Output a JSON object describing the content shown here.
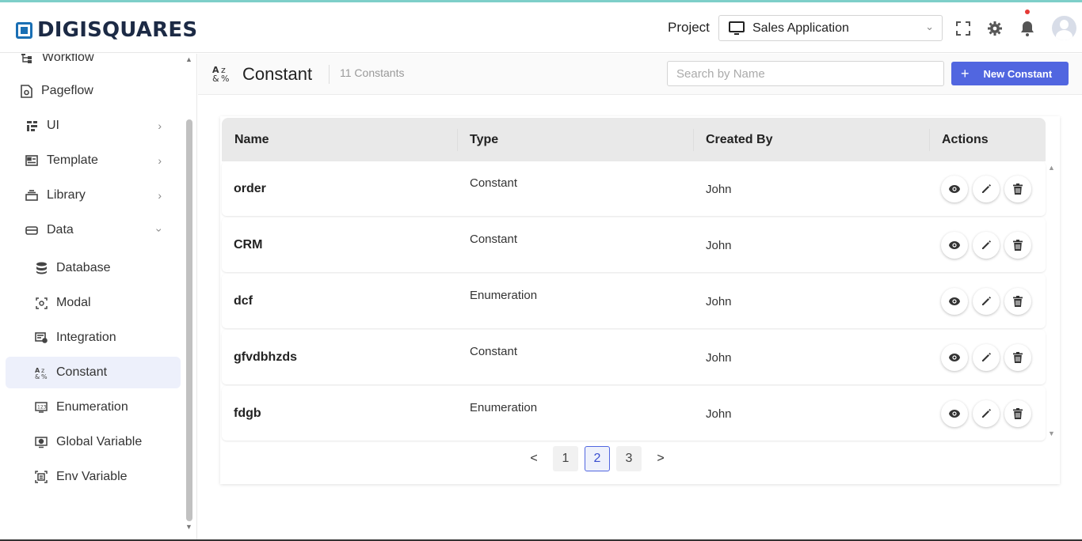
{
  "brand": {
    "name": "DIGISQUARES"
  },
  "header": {
    "project_label": "Project",
    "project_selected": "Sales Application",
    "icons": [
      "fullscreen-icon",
      "gear-icon",
      "bell-icon",
      "avatar"
    ]
  },
  "sidebar": {
    "items": [
      {
        "label": "Workflow",
        "icon": "workflow-icon",
        "has_arrow": false
      },
      {
        "label": "Pageflow",
        "icon": "pageflow-icon",
        "has_arrow": false
      },
      {
        "label": "UI",
        "icon": "ui-icon",
        "has_arrow": true
      },
      {
        "label": "Template",
        "icon": "template-icon",
        "has_arrow": true
      },
      {
        "label": "Library",
        "icon": "library-icon",
        "has_arrow": true
      },
      {
        "label": "Data",
        "icon": "data-icon",
        "has_arrow": true,
        "expanded": true
      },
      {
        "label": "Database",
        "icon": "database-icon"
      },
      {
        "label": "Modal",
        "icon": "modal-icon"
      },
      {
        "label": "Integration",
        "icon": "integration-icon"
      },
      {
        "label": "Constant",
        "icon": "constant-icon",
        "active": true
      },
      {
        "label": "Enumeration",
        "icon": "enumeration-icon"
      },
      {
        "label": "Global Variable",
        "icon": "global-variable-icon"
      },
      {
        "label": "Env Variable",
        "icon": "env-variable-icon"
      }
    ]
  },
  "toolbar": {
    "title": "Constant",
    "count": "11 Constants",
    "search_placeholder": "Search by Name",
    "new_button": "New Constant",
    "plus": "+"
  },
  "table": {
    "columns": [
      "Name",
      "Type",
      "Created By",
      "Actions"
    ],
    "rows": [
      {
        "name": "order",
        "type": "Constant",
        "created_by": "John"
      },
      {
        "name": "CRM",
        "type": "Constant",
        "created_by": "John"
      },
      {
        "name": "dcf",
        "type": "Enumeration",
        "created_by": "John"
      },
      {
        "name": "gfvdbhzds",
        "type": "Constant",
        "created_by": "John"
      },
      {
        "name": "fdgb",
        "type": "Enumeration",
        "created_by": "John"
      }
    ]
  },
  "pagination": {
    "prev": "<",
    "next": ">",
    "pages": [
      "1",
      "2",
      "3"
    ],
    "current": "2"
  },
  "colors": {
    "accent": "#5166e0",
    "brand": "#1a6fb4",
    "active_bg": "#edf0fb"
  }
}
